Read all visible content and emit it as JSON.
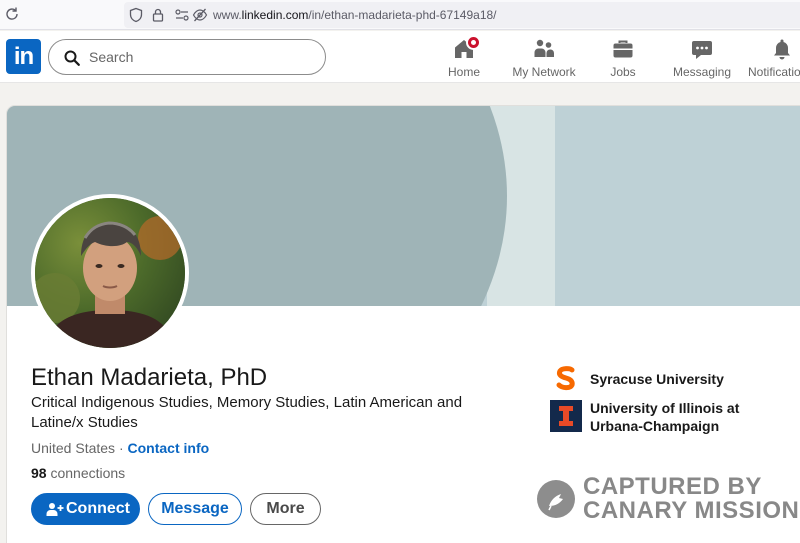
{
  "browser": {
    "url_prefix": "www.",
    "url_domain": "linkedin.com",
    "url_path": "/in/ethan-madarieta-phd-67149a18/"
  },
  "nav": {
    "logo_text": "in",
    "search_placeholder": "Search",
    "items": [
      {
        "label": "Home",
        "icon": "home-icon"
      },
      {
        "label": "My Network",
        "icon": "people-icon"
      },
      {
        "label": "Jobs",
        "icon": "briefcase-icon"
      },
      {
        "label": "Messaging",
        "icon": "chat-icon"
      },
      {
        "label": "Notifications",
        "icon": "bell-icon"
      }
    ]
  },
  "profile": {
    "name": "Ethan Madarieta, PhD",
    "headline": "Critical Indigenous Studies, Memory Studies, Latin American and Latine/x Studies",
    "location": "United States",
    "separator": " · ",
    "contact_info": "Contact info",
    "connections_count": "98",
    "connections_label": " connections"
  },
  "actions": {
    "connect": "Connect",
    "message": "Message",
    "more": "More"
  },
  "education": [
    {
      "name": "Syracuse University",
      "logo_letter": "S",
      "color": "#f76900"
    },
    {
      "name": "University of Illinois at Urbana-Champaign",
      "logo_letter": "I",
      "color": "#e84a27",
      "bg": "#13294b"
    }
  ],
  "watermark": {
    "line1": "CAPTURED BY",
    "line2": "CANARY MISSION"
  },
  "colors": {
    "brand": "#0a66c2",
    "notification": "#cb112d"
  }
}
